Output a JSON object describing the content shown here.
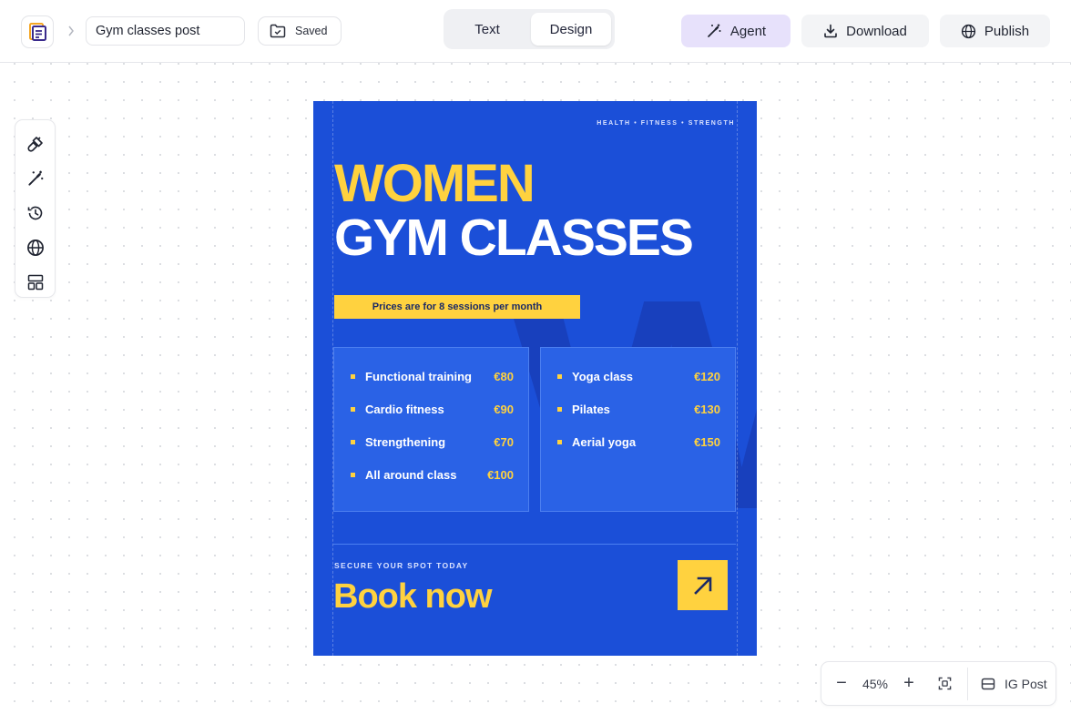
{
  "header": {
    "project_name": "Gym classes post",
    "saved_label": "Saved",
    "mode_tabs": [
      {
        "label": "Text",
        "active": false
      },
      {
        "label": "Design",
        "active": true
      }
    ],
    "agent_label": "Agent",
    "download_label": "Download",
    "publish_label": "Publish",
    "accent_agent_bg": "#e7e1fb"
  },
  "left_tools": [
    "brush-icon",
    "magic-wand-icon",
    "history-icon",
    "globe-icon",
    "layout-icon"
  ],
  "poster": {
    "tagline": "HEALTH • FITNESS • STRENGTH",
    "title_line1": "WOMEN",
    "title_line2": "GYM CLASSES",
    "price_note": "Prices are for 8 sessions per month",
    "bg_letter": "W",
    "classes_left": [
      {
        "name": "Functional training",
        "price": "€80"
      },
      {
        "name": "Cardio fitness",
        "price": "€90"
      },
      {
        "name": "Strengthening",
        "price": "€70"
      },
      {
        "name": "All around class",
        "price": "€100"
      }
    ],
    "classes_right": [
      {
        "name": "Yoga class",
        "price": "€120"
      },
      {
        "name": "Pilates",
        "price": "€130"
      },
      {
        "name": "Aerial yoga",
        "price": "€150"
      }
    ],
    "cta_kicker": "SECURE YOUR SPOT TODAY",
    "cta_title": "Book now",
    "colors": {
      "background": "#1b4fd8",
      "accent_yellow": "#ffd23f",
      "card_bg": "#2a62e6"
    }
  },
  "zoom_bar": {
    "minus": "−",
    "zoom": "45%",
    "plus": "+",
    "format_label": "IG Post"
  }
}
